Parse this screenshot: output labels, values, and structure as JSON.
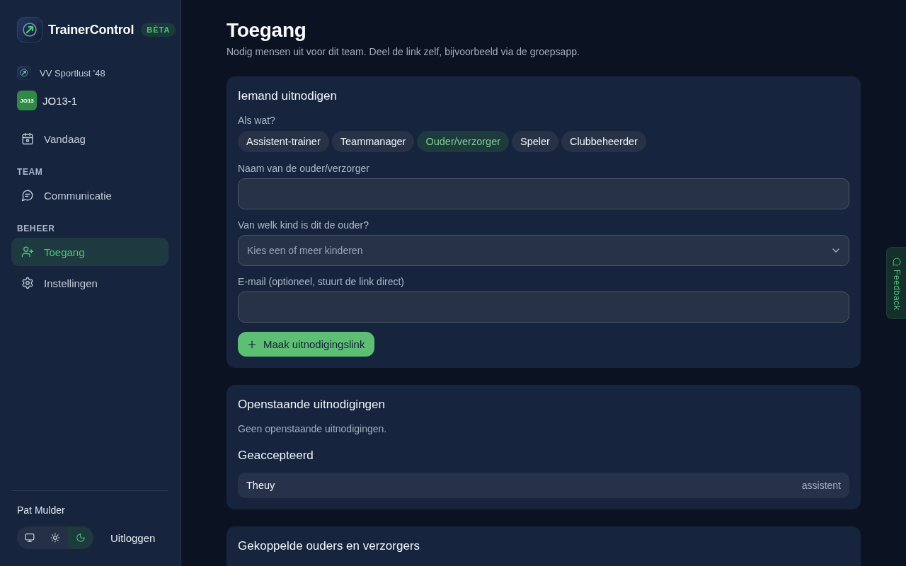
{
  "sidebar": {
    "brand": {
      "name": "TrainerControl",
      "badge": "BÈTA"
    },
    "club": "VV Sportlust '48",
    "team": {
      "code": "JO13",
      "name": "JO13-1"
    },
    "nav_sections": [
      {
        "items": [
          {
            "label": "Vandaag",
            "selected": false
          }
        ]
      },
      {
        "heading": "TEAM",
        "items": [
          {
            "label": "Communicatie",
            "selected": false
          }
        ]
      },
      {
        "heading": "BEHEER",
        "items": [
          {
            "label": "Toegang",
            "selected": true
          },
          {
            "label": "Instellingen",
            "selected": false
          }
        ]
      }
    ],
    "user": {
      "name": "Pat Mulder",
      "theme_options": [
        {
          "selected": false
        },
        {
          "selected": false
        },
        {
          "selected": true
        }
      ],
      "logout": "Uitloggen"
    }
  },
  "page": {
    "title": "Toegang",
    "subtitle": "Nodig mensen uit voor dit team. Deel de link zelf, bijvoorbeeld via de groepsapp."
  },
  "invite": {
    "title": "Iemand uitnodigen",
    "role_label": "Als wat?",
    "roles": [
      {
        "label": "Assistent-trainer",
        "selected": false
      },
      {
        "label": "Teammanager",
        "selected": false
      },
      {
        "label": "Ouder/verzorger",
        "selected": true
      },
      {
        "label": "Speler",
        "selected": false
      },
      {
        "label": "Clubbeheerder",
        "selected": false
      }
    ],
    "fields": [
      {
        "kind": "text",
        "label": "Naam van de ouder/verzorger"
      },
      {
        "kind": "select",
        "label": "Van welk kind is dit de ouder?",
        "placeholder": "Kies een of meer kinderen"
      },
      {
        "kind": "text",
        "label": "E-mail (optioneel, stuurt de link direct)"
      }
    ],
    "submit": "Maak uitnodigingslink"
  },
  "pending": {
    "title": "Openstaande uitnodigingen",
    "empty_text": "Geen openstaande uitnodigingen.",
    "accepted_title": "Geaccepteerd",
    "accepted": [
      {
        "name": "Theuy",
        "role": "assistent"
      }
    ]
  },
  "linked": {
    "title": "Gekoppelde ouders en verzorgers"
  },
  "feedback_tab": {
    "label": "Feedback"
  }
}
